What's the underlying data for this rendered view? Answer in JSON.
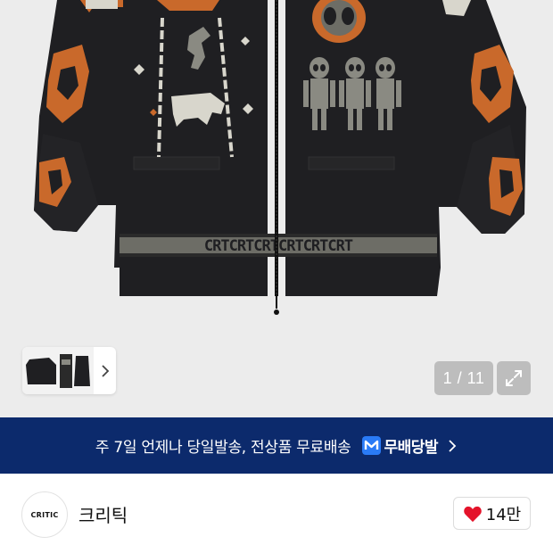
{
  "viewer": {
    "image_alt": "black knit zip-up cardigan with alien and ufo intarsia",
    "knit_text": "CRTCRTCRTCRTCRTCRT",
    "page_current": "1",
    "page_total": "11",
    "page_counter_text": "1 / 11",
    "icons": {
      "thumb_next": "chevron-right-icon",
      "expand": "expand-arrows-icon"
    }
  },
  "banner": {
    "text": "주 7일 언제나 당일발송, 전상품 무료배송",
    "badge_label": "무배당발",
    "badge_icon": "m-logo-icon",
    "chevron_icon": "chevron-right-icon",
    "background": "#0c2a6c"
  },
  "seller": {
    "logo_text": "CRITIC",
    "name": "크리틱",
    "like_count": "14만",
    "heart_icon": "heart-icon",
    "heart_color": "#e4132a"
  }
}
